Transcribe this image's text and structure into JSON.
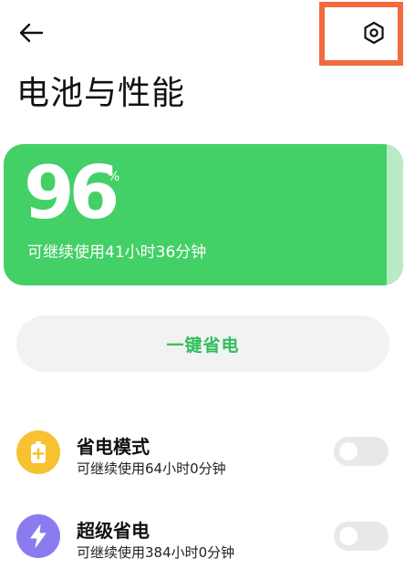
{
  "header": {
    "title": "电池与性能",
    "back_icon": "arrow-left-icon",
    "settings_icon": "hexagon-settings-icon",
    "highlight_color": "#f26a3d"
  },
  "battery": {
    "percent": "96",
    "percent_symbol": "%",
    "remaining": "可继续使用41小时36分钟",
    "card_color": "#43d066"
  },
  "one_key_save": {
    "label": "一键省电",
    "color": "#2fbf5c"
  },
  "modes": [
    {
      "title": "省电模式",
      "subtitle": "可继续使用64小时0分钟",
      "icon": "battery-plus-icon",
      "icon_color": "#f7c12f",
      "enabled": false
    },
    {
      "title": "超级省电",
      "subtitle": "可继续使用384小时0分钟",
      "icon": "lightning-icon",
      "icon_color": "#8a7cf0",
      "enabled": false
    }
  ]
}
